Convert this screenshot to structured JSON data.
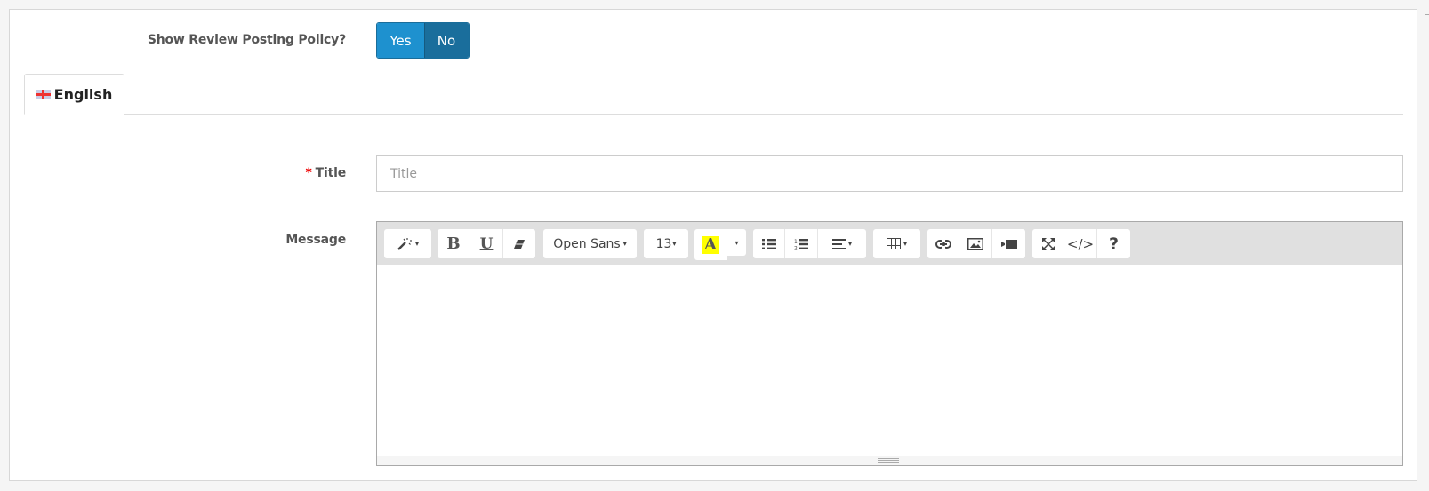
{
  "policy": {
    "label": "Show Review Posting Policy?",
    "options": {
      "yes": "Yes",
      "no": "No"
    },
    "selected": "No",
    "colors": {
      "yes": "#1e91cf",
      "no": "#1a6e9c"
    }
  },
  "tabs": [
    {
      "label": "English",
      "icon": "uk-flag-icon",
      "active": true
    }
  ],
  "title_field": {
    "required_marker": "*",
    "label": "Title",
    "value": "",
    "placeholder": "Title"
  },
  "message_field": {
    "label": "Message",
    "content": "",
    "toolbar": {
      "style": {
        "icon": "magic-wand-icon",
        "caret": "▾"
      },
      "bold": "B",
      "underline": "U",
      "clear_format": {
        "icon": "eraser-icon"
      },
      "font_name": "Open Sans",
      "font_size": "13",
      "color": {
        "label": "A",
        "highlight": "#ffff00"
      },
      "unordered_list": {
        "icon": "unordered-list-icon"
      },
      "ordered_list": {
        "icon": "ordered-list-icon"
      },
      "paragraph": {
        "icon": "align-left-icon"
      },
      "table": {
        "icon": "table-icon"
      },
      "link": {
        "icon": "link-icon"
      },
      "picture": {
        "icon": "picture-icon"
      },
      "video": {
        "icon": "video-icon"
      },
      "fullscreen": {
        "icon": "fullscreen-icon"
      },
      "codeview": "</>",
      "help": "?"
    }
  }
}
